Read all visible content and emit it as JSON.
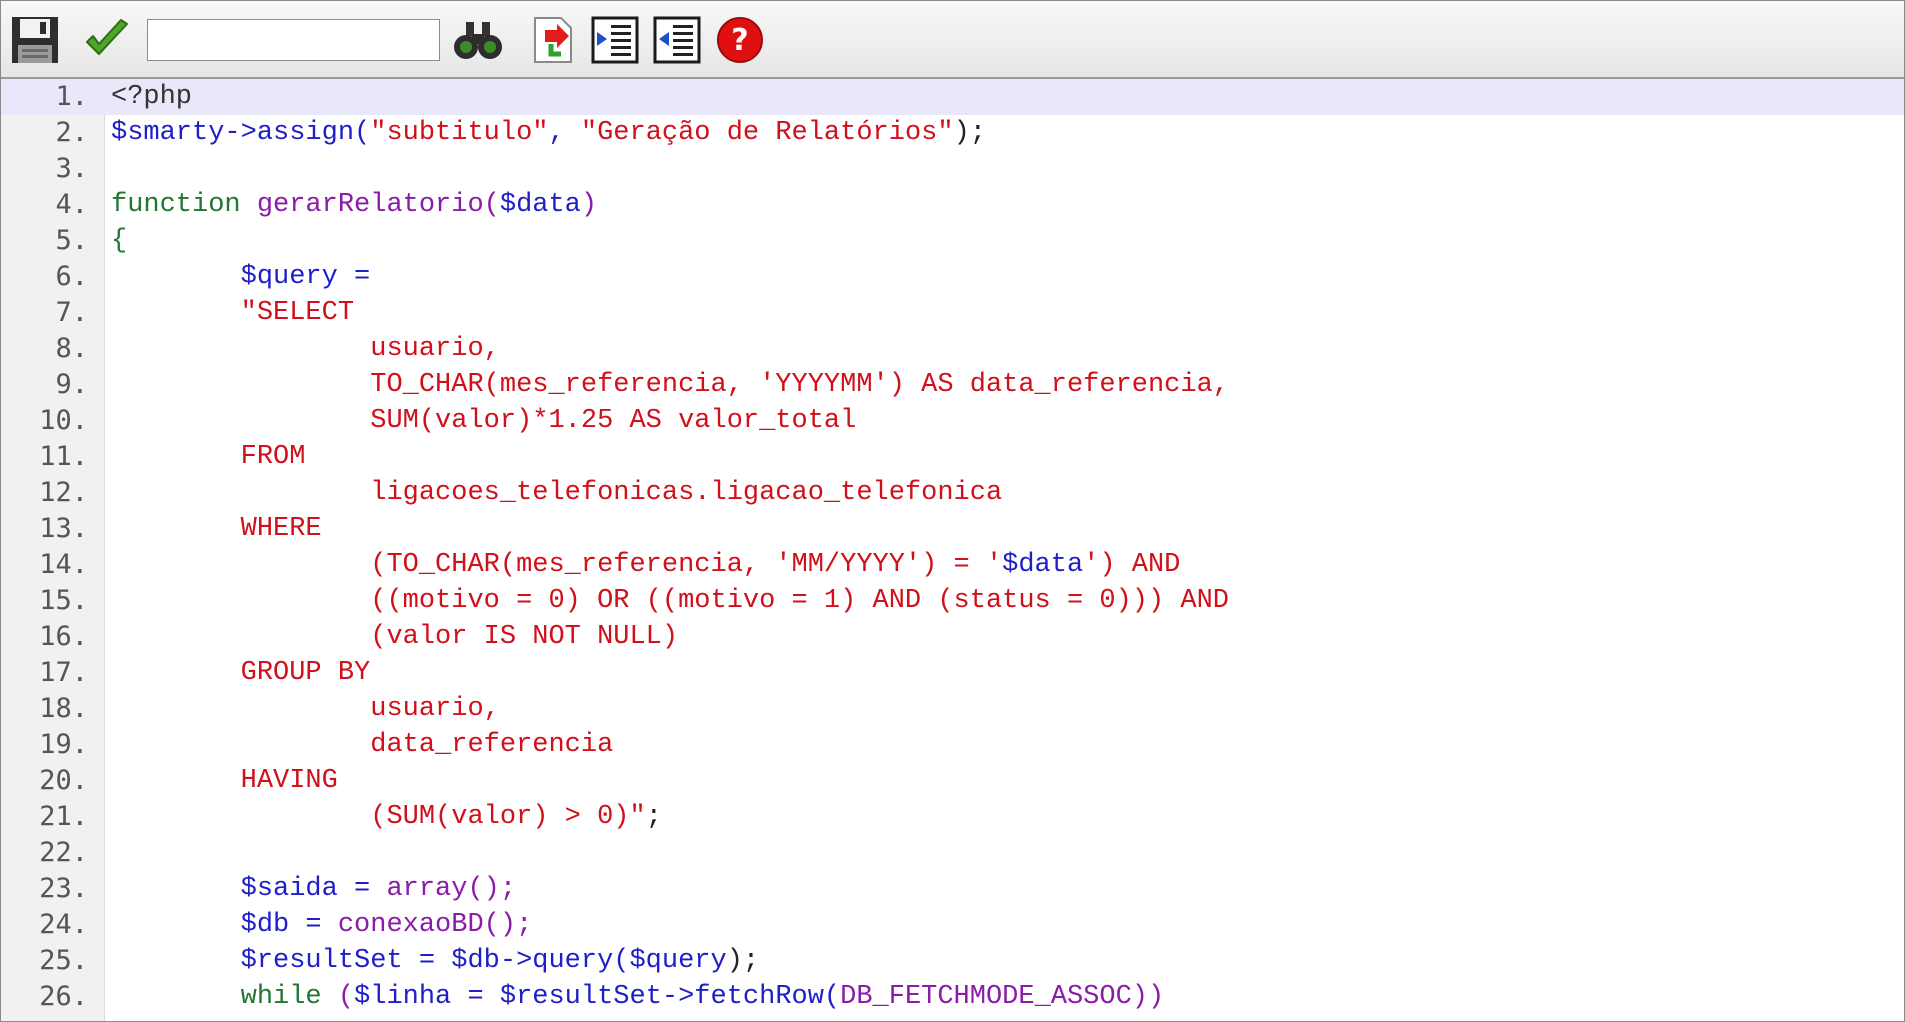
{
  "toolbar": {
    "search_value": "",
    "icons": [
      "save-icon",
      "check-icon",
      "find-icon",
      "goto-line-icon",
      "indent-icon",
      "outdent-icon",
      "help-icon"
    ]
  },
  "colors": {
    "var": "#1f1fc8",
    "string": "#d0101b",
    "keyword": "#207830",
    "function": "#8a1ca8",
    "active_line": "#e8e8fa"
  },
  "editor": {
    "active_line": 1,
    "lines": [
      {
        "n": "1.",
        "tokens": [
          {
            "t": "<?php",
            "c": "tag"
          }
        ]
      },
      {
        "n": "2.",
        "tokens": [
          {
            "t": "$smarty",
            "c": "var"
          },
          {
            "t": "->assign(",
            "c": "var"
          },
          {
            "t": "\"subtitulo\"",
            "c": "str"
          },
          {
            "t": ", ",
            "c": "var"
          },
          {
            "t": "\"Geração de Relatórios\"",
            "c": "str"
          },
          {
            "t": ");",
            "c": "plain"
          }
        ]
      },
      {
        "n": "3.",
        "tokens": []
      },
      {
        "n": "4.",
        "tokens": [
          {
            "t": "function ",
            "c": "kw"
          },
          {
            "t": "gerarRelatorio(",
            "c": "fn"
          },
          {
            "t": "$data",
            "c": "var"
          },
          {
            "t": ")",
            "c": "fn"
          }
        ]
      },
      {
        "n": "5.",
        "tokens": [
          {
            "t": "{",
            "c": "kw"
          }
        ]
      },
      {
        "n": "6.",
        "tokens": [
          {
            "t": "        $query =",
            "c": "var"
          }
        ]
      },
      {
        "n": "7.",
        "tokens": [
          {
            "t": "        \"SELECT",
            "c": "str"
          }
        ]
      },
      {
        "n": "8.",
        "tokens": [
          {
            "t": "                usuario,",
            "c": "str"
          }
        ]
      },
      {
        "n": "9.",
        "tokens": [
          {
            "t": "                TO_CHAR(mes_referencia, 'YYYYMM') AS data_referencia,",
            "c": "str"
          }
        ]
      },
      {
        "n": "10.",
        "tokens": [
          {
            "t": "                SUM(valor)*1.25 AS valor_total",
            "c": "str"
          }
        ]
      },
      {
        "n": "11.",
        "tokens": [
          {
            "t": "        FROM",
            "c": "str"
          }
        ]
      },
      {
        "n": "12.",
        "tokens": [
          {
            "t": "                ligacoes_telefonicas.ligacao_telefonica",
            "c": "str"
          }
        ]
      },
      {
        "n": "13.",
        "tokens": [
          {
            "t": "        WHERE",
            "c": "str"
          }
        ]
      },
      {
        "n": "14.",
        "tokens": [
          {
            "t": "                (TO_CHAR(mes_referencia, 'MM/YYYY') = '",
            "c": "str"
          },
          {
            "t": "$data",
            "c": "var"
          },
          {
            "t": "') AND",
            "c": "str"
          }
        ]
      },
      {
        "n": "15.",
        "tokens": [
          {
            "t": "                ((motivo = 0) OR ((motivo = 1) AND (status = 0))) AND",
            "c": "str"
          }
        ]
      },
      {
        "n": "16.",
        "tokens": [
          {
            "t": "                (valor IS NOT NULL)",
            "c": "str"
          }
        ]
      },
      {
        "n": "17.",
        "tokens": [
          {
            "t": "        GROUP BY",
            "c": "str"
          }
        ]
      },
      {
        "n": "18.",
        "tokens": [
          {
            "t": "                usuario,",
            "c": "str"
          }
        ]
      },
      {
        "n": "19.",
        "tokens": [
          {
            "t": "                data_referencia",
            "c": "str"
          }
        ]
      },
      {
        "n": "20.",
        "tokens": [
          {
            "t": "        HAVING",
            "c": "str"
          }
        ]
      },
      {
        "n": "21.",
        "tokens": [
          {
            "t": "                (SUM(valor) > 0)\"",
            "c": "str"
          },
          {
            "t": ";",
            "c": "plain"
          }
        ]
      },
      {
        "n": "22.",
        "tokens": []
      },
      {
        "n": "23.",
        "tokens": [
          {
            "t": "        $saida = ",
            "c": "var"
          },
          {
            "t": "array();",
            "c": "fn"
          }
        ]
      },
      {
        "n": "24.",
        "tokens": [
          {
            "t": "        $db = ",
            "c": "var"
          },
          {
            "t": "conexaoBD();",
            "c": "fn"
          }
        ]
      },
      {
        "n": "25.",
        "tokens": [
          {
            "t": "        $resultSet = $db->query(",
            "c": "var"
          },
          {
            "t": "$query",
            "c": "var"
          },
          {
            "t": ");",
            "c": "plain"
          }
        ]
      },
      {
        "n": "26.",
        "tokens": [
          {
            "t": "        while ",
            "c": "kw"
          },
          {
            "t": "(",
            "c": "fn"
          },
          {
            "t": "$linha = $resultSet->fetchRow(",
            "c": "var"
          },
          {
            "t": "DB_FETCHMODE_ASSOC",
            "c": "fn"
          },
          {
            "t": "))",
            "c": "fn"
          }
        ]
      }
    ]
  }
}
